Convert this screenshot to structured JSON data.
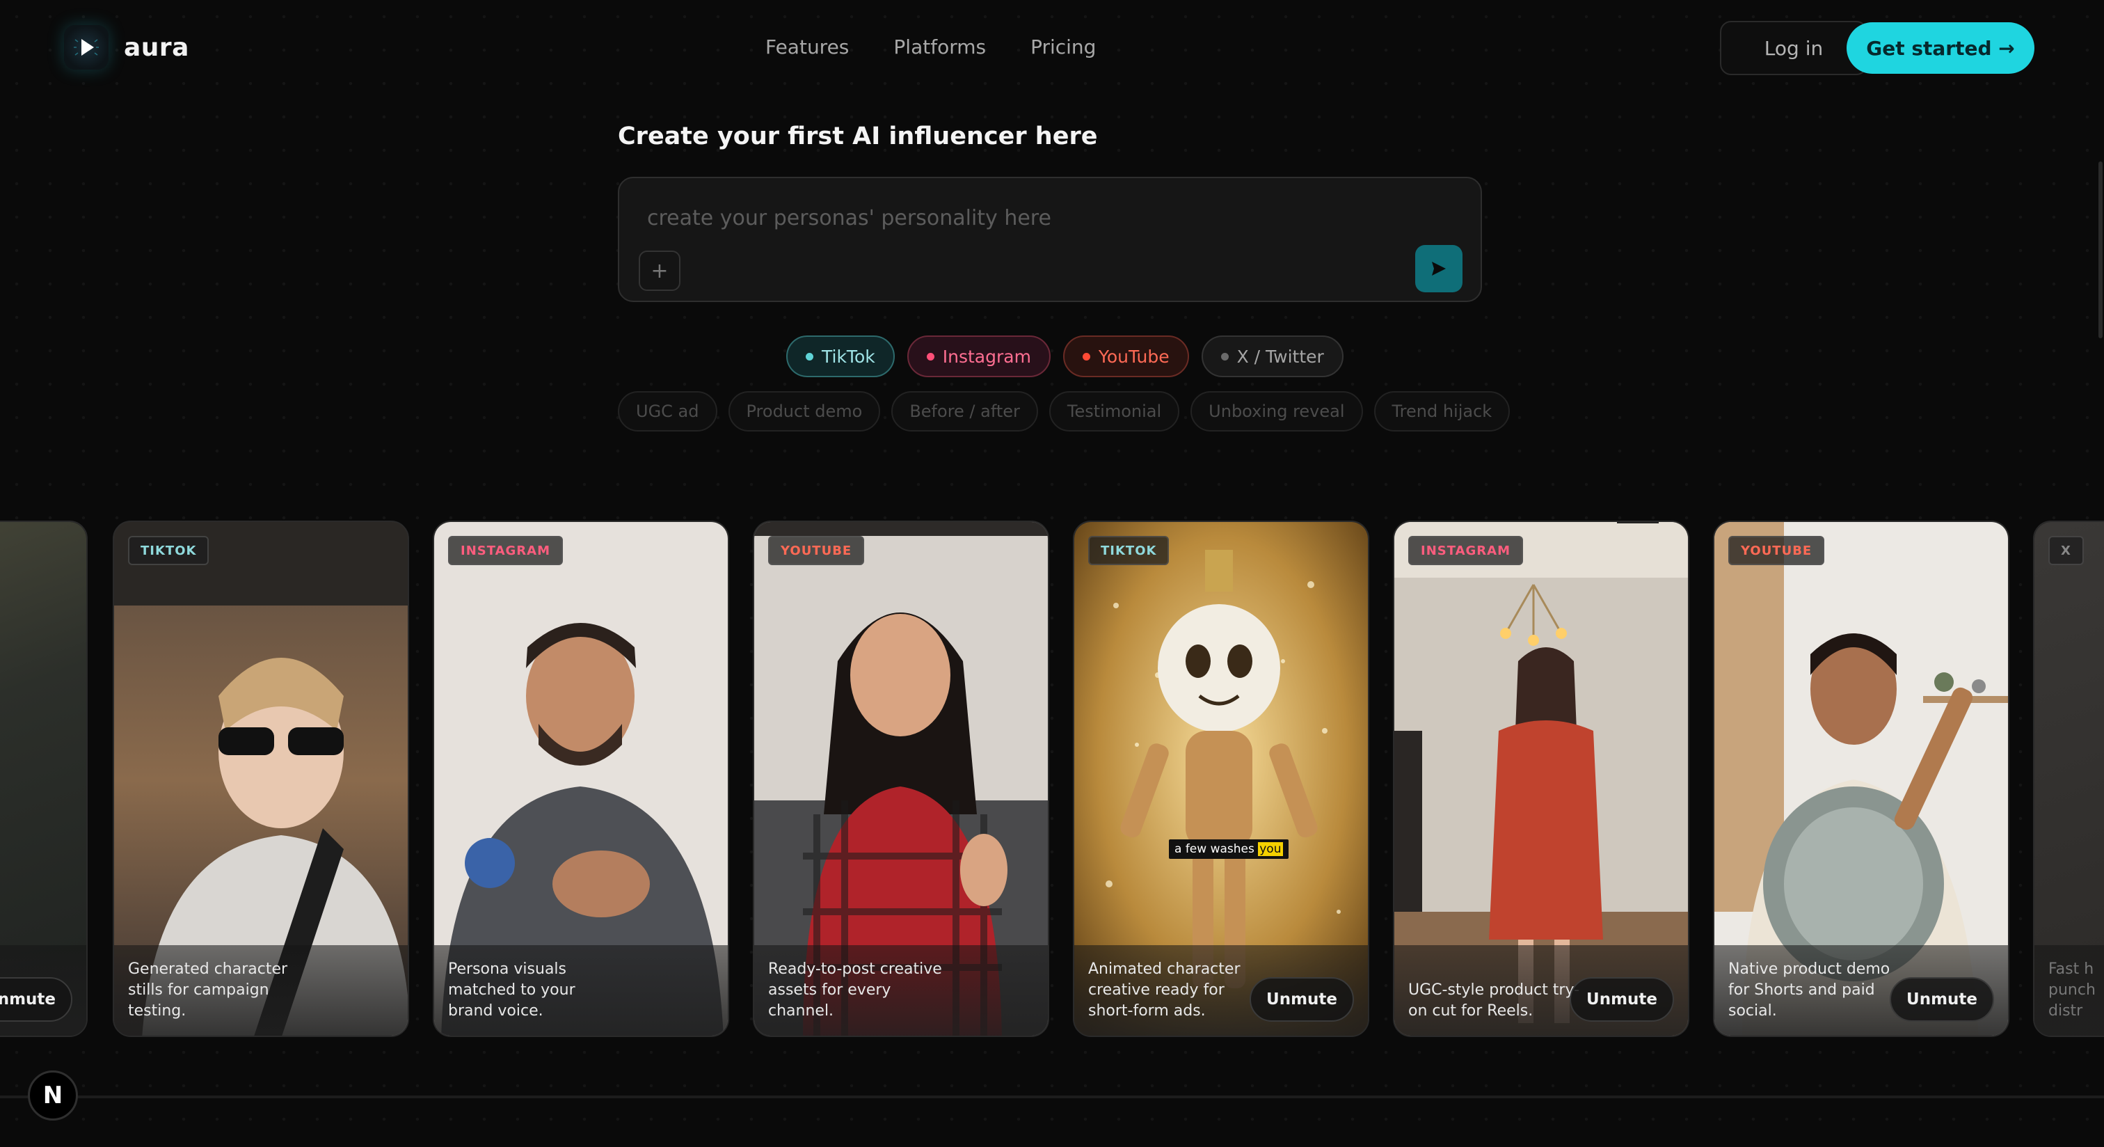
{
  "brand": {
    "name": "aura",
    "logo_icon": "play-triangle-icon",
    "accent": "#1fd5e0"
  },
  "nav": {
    "items": [
      "Features",
      "Platforms",
      "Pricing"
    ]
  },
  "header": {
    "login_label": "Log in",
    "cta_label": "Get started →"
  },
  "composer": {
    "title": "Create your first AI influencer here",
    "placeholder": "create your personas' personality here",
    "plus_label": "+",
    "send_icon": "send-icon"
  },
  "platforms": [
    {
      "label": "TikTok",
      "color": "#5fd3d6"
    },
    {
      "label": "Instagram",
      "color": "#ff4f78"
    },
    {
      "label": "YouTube",
      "color": "#ff4a35"
    },
    {
      "label": "X / Twitter",
      "color": "#6a6a6a"
    }
  ],
  "templates": [
    "UGC ad",
    "Product demo",
    "Before / after",
    "Testimonial",
    "Unboxing reveal",
    "Trend hijack"
  ],
  "cards": [
    {
      "badge": "",
      "caption": "",
      "unmute": "Unmute"
    },
    {
      "badge": "TIKTOK",
      "caption": "Generated character stills for campaign testing.",
      "unmute": ""
    },
    {
      "badge": "INSTAGRAM",
      "caption": "Persona visuals matched to your brand voice.",
      "unmute": ""
    },
    {
      "badge": "YOUTUBE",
      "caption": "Ready-to-post creative assets for every channel.",
      "unmute": ""
    },
    {
      "badge": "TIKTOK",
      "caption": "Animated character creative ready for short-form ads.",
      "unmute": "Unmute",
      "overlay_text": "a few washes",
      "overlay_highlight": "you"
    },
    {
      "badge": "INSTAGRAM",
      "caption": "UGC-style product try-on cut for Reels.",
      "unmute": "Unmute"
    },
    {
      "badge": "YOUTUBE",
      "caption": "Native product demo for Shorts and paid social.",
      "unmute": "Unmute"
    },
    {
      "badge": "X",
      "caption": "Fast h punch distr",
      "unmute": ""
    }
  ],
  "footer": {
    "next_badge": "N"
  }
}
